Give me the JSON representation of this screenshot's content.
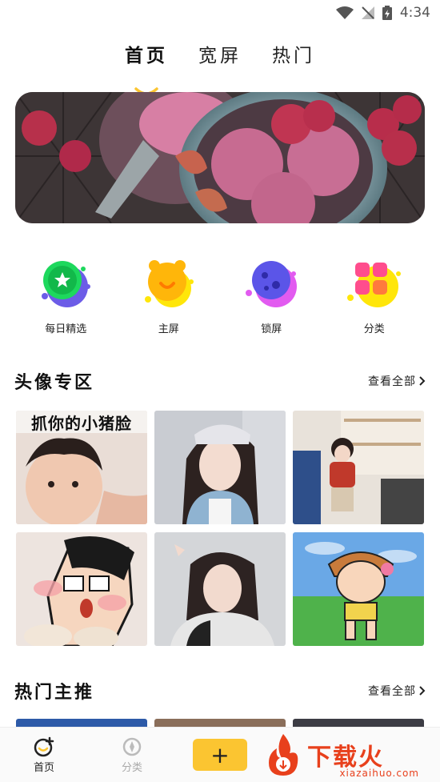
{
  "status": {
    "time": "4:34"
  },
  "tabs": [
    {
      "label": "首页",
      "active": true
    },
    {
      "label": "宽屏",
      "active": false
    },
    {
      "label": "热门",
      "active": false
    }
  ],
  "quick": [
    {
      "label": "每日精选",
      "icon": "daily-pick-icon"
    },
    {
      "label": "主屏",
      "icon": "home-screen-icon"
    },
    {
      "label": "锁屏",
      "icon": "lock-screen-icon"
    },
    {
      "label": "分类",
      "icon": "category-icon"
    }
  ],
  "avatar_section": {
    "title": "头像专区",
    "view_all": "查看全部"
  },
  "avatar_thumbs": [
    {
      "caption": "抓你的小猪脸"
    },
    {
      "caption": ""
    },
    {
      "caption": ""
    },
    {
      "caption": ""
    },
    {
      "caption": ""
    },
    {
      "caption": ""
    }
  ],
  "hot_section": {
    "title": "热门主推",
    "view_all": "查看全部"
  },
  "bottom_nav": {
    "home": "首页",
    "category": "分类",
    "add": "+"
  },
  "watermark": {
    "text": "下载火",
    "url": "xiazaihuo.com"
  },
  "colors": {
    "accent": "#fbc531",
    "watermark": "#e8401c"
  }
}
